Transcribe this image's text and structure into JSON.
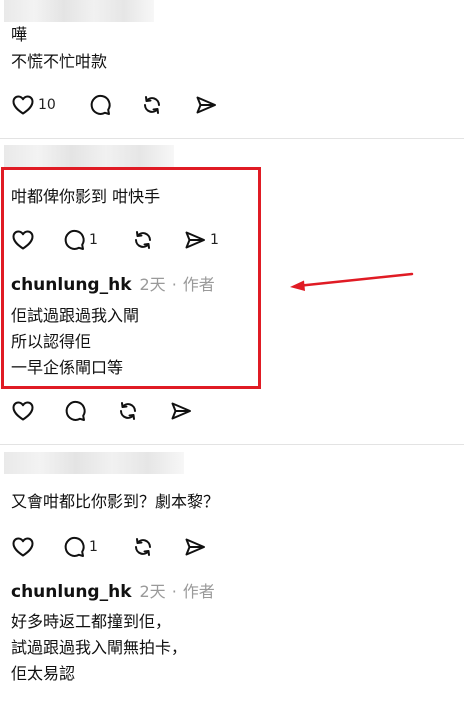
{
  "post1": {
    "line1": "嘩",
    "line2": "不慌不忙咁款",
    "like_count": "10"
  },
  "post2": {
    "text": "咁都俾你影到 咁快手",
    "reply_count": "1",
    "share_count": "1",
    "reply": {
      "username": "chunlung_hk",
      "time": "2天",
      "role": "作者",
      "line1": "佢試過跟過我入閘",
      "line2": "所以認得佢",
      "line3": "一早企係閘口等"
    }
  },
  "post3": {
    "text": "又會咁都比你影到？劇本黎？",
    "reply_count": "1",
    "reply": {
      "username": "chunlung_hk",
      "time": "2天",
      "role": "作者",
      "line1": "好多時返工都撞到佢，",
      "line2": "試過跟過我入閘無拍卡，",
      "line3": "佢太易認"
    }
  },
  "annotation_color": "#e01b24"
}
